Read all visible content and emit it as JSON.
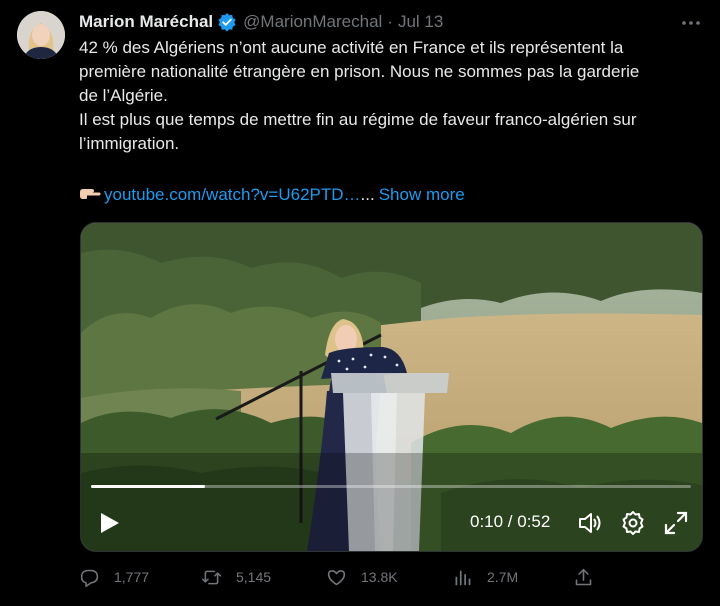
{
  "author": {
    "name": "Marion Maréchal",
    "handle": "@MarionMarechal",
    "separator": "·",
    "date": "Jul 13"
  },
  "tweet": {
    "line1": "42 % des Algériens n’ont aucune activité en France et ils représentent la",
    "line2": "première nationalité étrangère en prison. Nous ne sommes pas la garderie",
    "line3": "de l’Algérie.",
    "line4": "Il est plus que temps de mettre fin au régime de faveur franco-algérien sur",
    "line5": "l’immigration.",
    "link_text": "youtube.com/watch?v=U62PTD…",
    "ellipsis": "...",
    "show_more": "Show more"
  },
  "video": {
    "time": "0:10 / 0:52",
    "progress": 0.19
  },
  "actions": {
    "replies": "1,777",
    "reposts": "5,145",
    "likes": "13.8K",
    "views": "2.7M"
  },
  "colors": {
    "background": "#000000",
    "text": "#e7e9ea",
    "muted": "#71767b",
    "link": "#1d9bf0",
    "verified": "#1d9bf0"
  },
  "icons": [
    "verified-badge-icon",
    "more-icon",
    "pointing-hand-icon",
    "play-icon",
    "volume-icon",
    "settings-icon",
    "fullscreen-icon",
    "reply-icon",
    "repost-icon",
    "like-icon",
    "views-icon",
    "share-icon"
  ]
}
